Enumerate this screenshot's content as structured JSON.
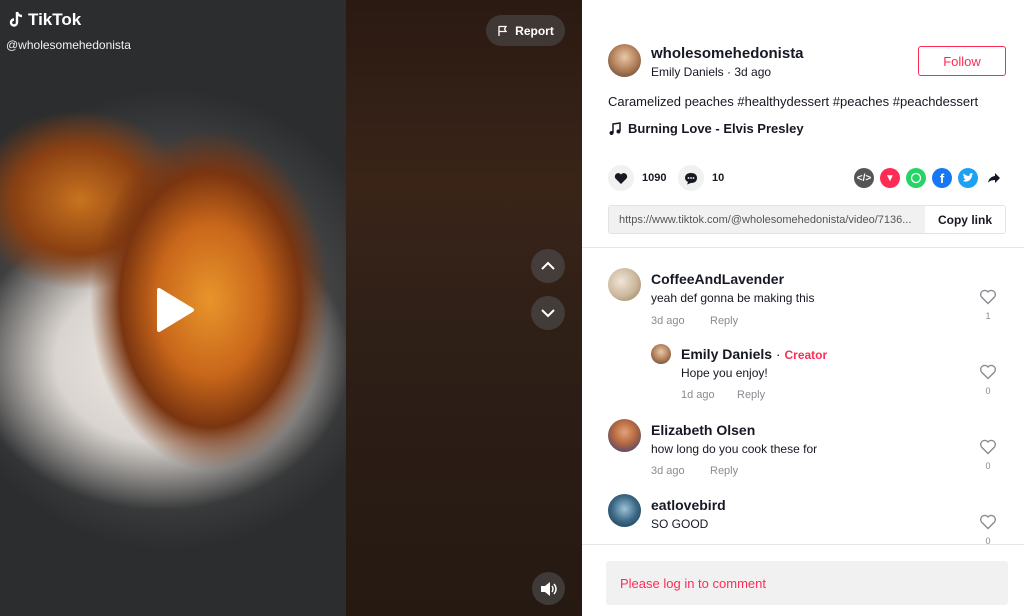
{
  "brand": {
    "name": "TikTok",
    "handle": "@wholesomehedonista"
  },
  "video": {
    "report_label": "Report"
  },
  "post": {
    "username": "wholesomehedonista",
    "display_name": "Emily Daniels",
    "time": "3d ago",
    "follow_label": "Follow",
    "caption_text": "Caramelized peaches",
    "hashtags": [
      "#healthydessert",
      "#peaches",
      "#peachdessert"
    ],
    "music": "Burning Love - Elvis Presley",
    "likes": "1090",
    "comments": "10",
    "link": "https://www.tiktok.com/@wholesomehedonista/video/7136...",
    "copy_label": "Copy link"
  },
  "comments": [
    {
      "name": "CoffeeAndLavender",
      "text": "yeah def gonna be making this",
      "time": "3d ago",
      "reply": "Reply",
      "likes": "1"
    },
    {
      "name": "Emily Daniels",
      "badge": "Creator",
      "separator": " · ",
      "text": "Hope you enjoy!",
      "time": "1d ago",
      "reply": "Reply",
      "likes": "0"
    },
    {
      "name": "Elizabeth Olsen",
      "text": "how long do you cook these for",
      "time": "3d ago",
      "reply": "Reply",
      "likes": "0"
    },
    {
      "name": "eatlovebird",
      "text": "SO GOOD",
      "likes": "0"
    }
  ],
  "login_prompt": "Please log in to comment",
  "colors": {
    "accent": "#fe2c55",
    "text": "#161823",
    "muted": "#8a8b91"
  }
}
